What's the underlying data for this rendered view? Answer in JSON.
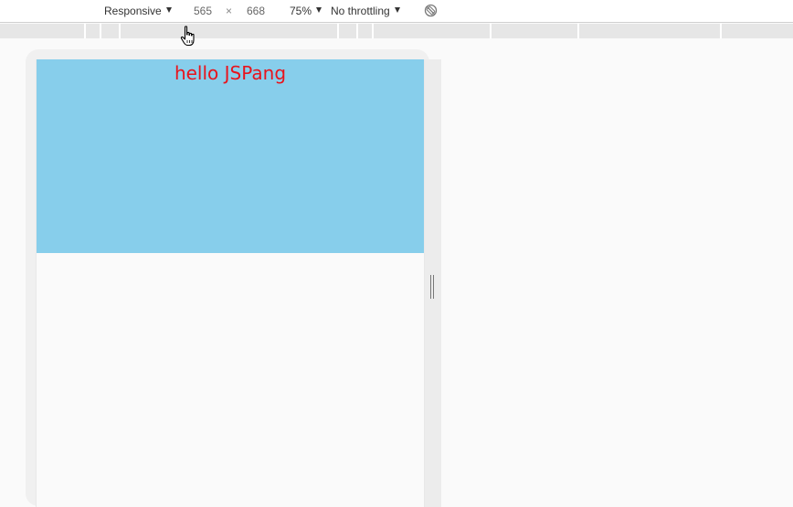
{
  "toolbar": {
    "device_mode": "Responsive",
    "width": "565",
    "times": "×",
    "height": "668",
    "zoom": "75%",
    "throttling": "No throttling",
    "rotate_icon": "rotate-disabled-icon"
  },
  "ruler": {
    "color": "#e6e6e6"
  },
  "viewport": {
    "box_color": "#87ceeb",
    "text": "hello JSPang",
    "text_color": "#e8141c"
  },
  "cursor": "hand-pointer-icon"
}
